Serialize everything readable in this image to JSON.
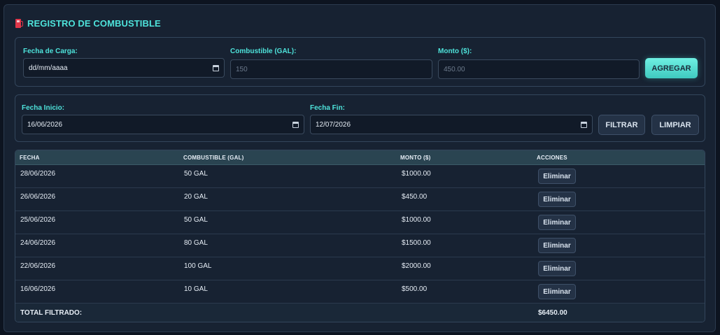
{
  "header": {
    "title": "REGISTRO DE COMBUSTIBLE",
    "icon": "fuel-pump-icon"
  },
  "form": {
    "date_label": "Fecha de Carga:",
    "date_value": "dd/mm/aaaa",
    "fuel_label": "Combustible (GAL):",
    "fuel_placeholder": "150",
    "amount_label": "Monto ($):",
    "amount_placeholder": "450.00",
    "add_label": "AGREGAR"
  },
  "filter": {
    "start_label": "Fecha Inicio:",
    "start_value": "16/06/2026",
    "end_label": "Fecha Fin:",
    "end_value": "12/07/2026",
    "filter_label": "FILTRAR",
    "clear_label": "LIMPIAR"
  },
  "table": {
    "headers": [
      "FECHA",
      "COMBUSTIBLE (GAL)",
      "MONTO ($)",
      "ACCIONES"
    ],
    "delete_label": "Eliminar",
    "rows": [
      {
        "date": "28/06/2026",
        "fuel": "50 GAL",
        "amount": "$1000.00"
      },
      {
        "date": "26/06/2026",
        "fuel": "20 GAL",
        "amount": "$450.00"
      },
      {
        "date": "25/06/2026",
        "fuel": "50 GAL",
        "amount": "$1000.00"
      },
      {
        "date": "24/06/2026",
        "fuel": "80 GAL",
        "amount": "$1500.00"
      },
      {
        "date": "22/06/2026",
        "fuel": "100 GAL",
        "amount": "$2000.00"
      },
      {
        "date": "16/06/2026",
        "fuel": "10 GAL",
        "amount": "$500.00"
      }
    ],
    "total_label": "TOTAL FILTRADO:",
    "total_value": "$6450.00"
  },
  "colors": {
    "accent": "#4ee3db",
    "background": "#172232",
    "danger_icon": "#e0374a"
  }
}
